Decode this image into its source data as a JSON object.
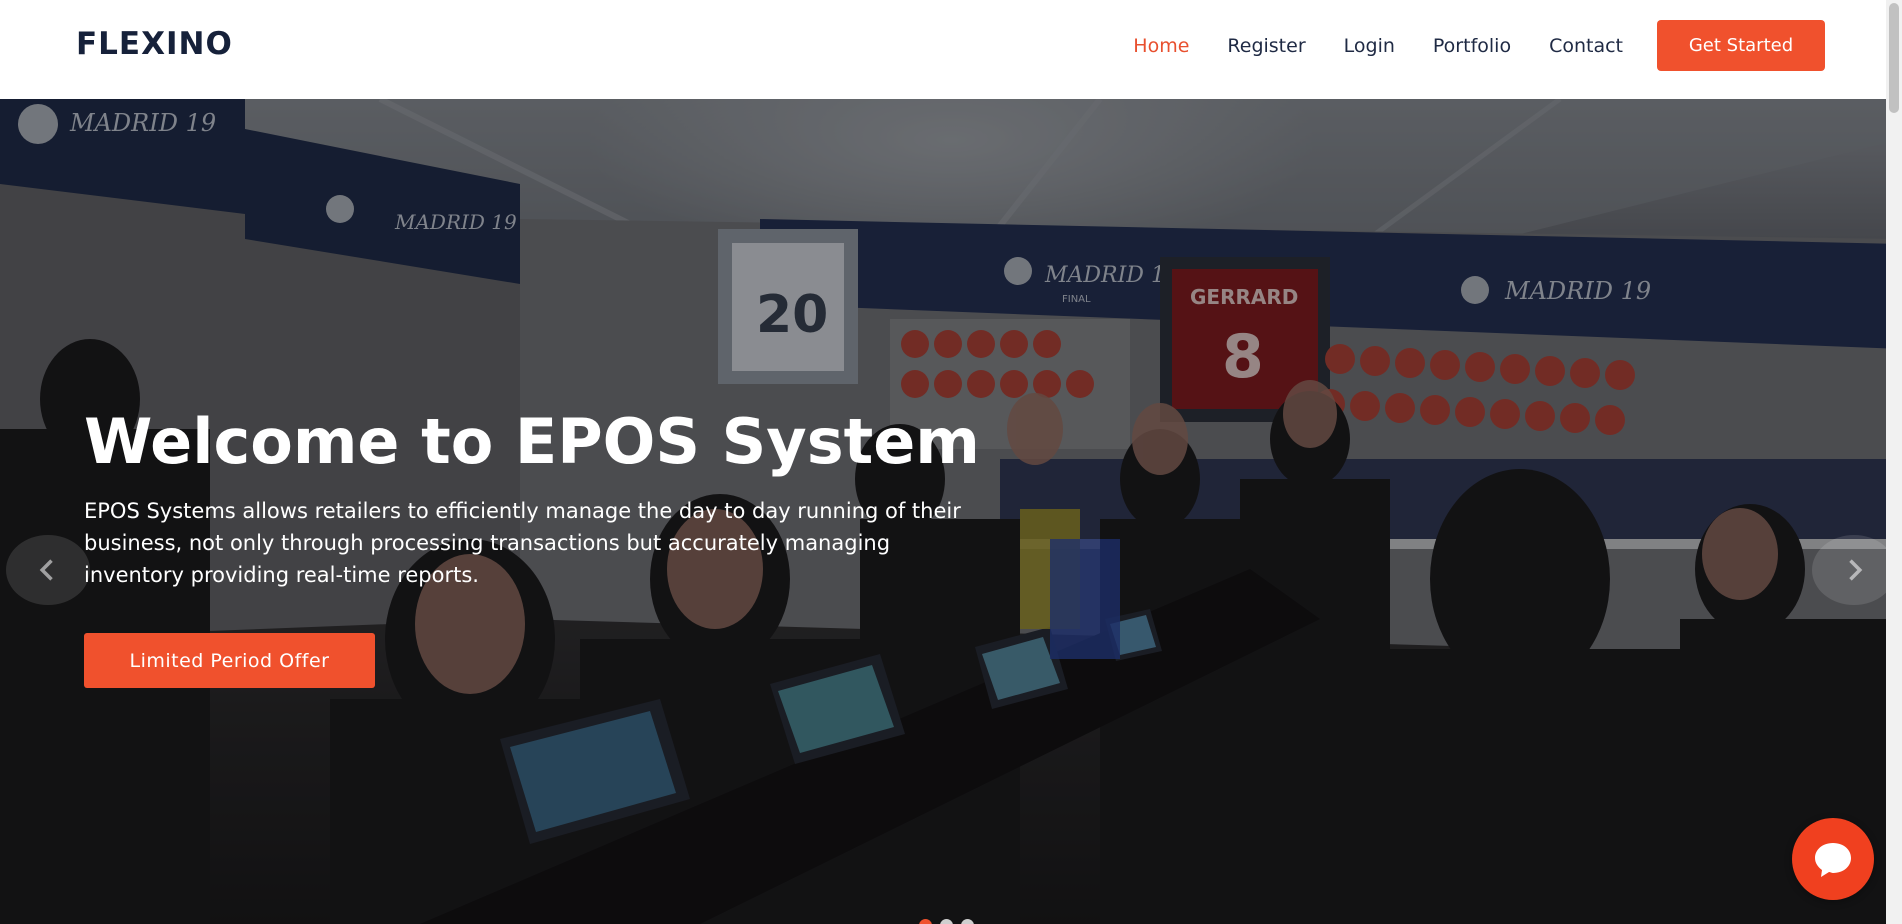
{
  "header": {
    "logo": "FLEXINO",
    "nav": [
      {
        "label": "Home",
        "active": true
      },
      {
        "label": "Register",
        "active": false
      },
      {
        "label": "Login",
        "active": false
      },
      {
        "label": "Portfolio",
        "active": false
      },
      {
        "label": "Contact",
        "active": false
      }
    ],
    "cta_label": "Get Started"
  },
  "hero": {
    "title": "Welcome to EPOS System",
    "description": "EPOS Systems allows retailers to efficiently manage the day to day running of their business, not only through processing transactions but accurately managing inventory providing real-time reports.",
    "button_label": "Limited Period Offer",
    "background_image": "store-counter-photo",
    "signage_text": [
      "MADRID 19",
      "FINAL",
      "GERRARD",
      "8",
      "20"
    ]
  },
  "carousel": {
    "prev_icon": "chevron-left-icon",
    "next_icon": "chevron-right-icon",
    "slide_count": 3,
    "active_slide": 1
  },
  "chat": {
    "icon": "chat-bubble-icon"
  },
  "colors": {
    "accent": "#f0512d",
    "logo": "#16213a",
    "nav_text": "#1f2a44",
    "nav_active": "#e8502f"
  }
}
